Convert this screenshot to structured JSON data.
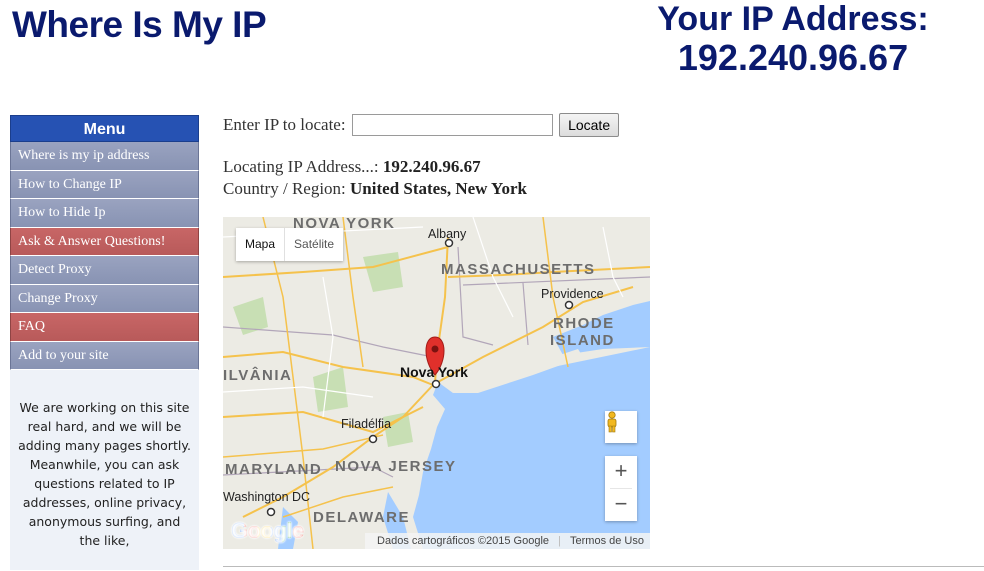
{
  "site_title": "Where Is My IP",
  "ip_header": {
    "label": "Your IP Address:",
    "value": "192.240.96.67"
  },
  "sidebar": {
    "menu_title": "Menu",
    "items": [
      {
        "label": "Where is my ip address"
      },
      {
        "label": "How to Change IP"
      },
      {
        "label": "How to Hide Ip"
      },
      {
        "label": "Ask & Answer Questions!"
      },
      {
        "label": "Detect Proxy"
      },
      {
        "label": "Change Proxy"
      },
      {
        "label": "FAQ"
      },
      {
        "label": "Add to your site"
      }
    ],
    "info_text": "We are working on this site real hard, and we will be adding many pages shortly. Meanwhile, you can ask questions related to IP addresses, online privacy, anonymous surfing, and the like,"
  },
  "locate": {
    "label": "Enter IP to locate:",
    "input_value": "",
    "button_label": "Locate"
  },
  "result": {
    "locating_label": "Locating IP Address...:",
    "locating_value": "192.240.96.67",
    "region_label": "Country / Region:",
    "region_value": "United States, New York"
  },
  "map": {
    "type_map": "Mapa",
    "type_satellite": "Satélite",
    "labels": {
      "nova_york_top": "NOVA YORK",
      "albany": "Albany",
      "massachusetts": "MASSACHUSETTS",
      "providence": "Providence",
      "rhode": "RHODE",
      "island": "ISLAND",
      "pennsylvania": "ILVÂNIA",
      "nova_york_city": "Nova York",
      "filadelfia": "Filadélfia",
      "maryland": "MARYLAND",
      "nova_jersey": "NOVA JERSEY",
      "washington": "Washington DC",
      "delaware": "DELAWARE"
    },
    "zoom_in": "+",
    "zoom_out": "−",
    "attribution": "Dados cartográficos ©2015 Google",
    "terms": "Termos de Uso",
    "logo": "Google"
  },
  "colors": {
    "title": "#0a1a6e",
    "menu_header": "#2652b3",
    "menu_item": "#8893b3",
    "menu_hot": "#b85a5a",
    "water": "#a3ccff",
    "land": "#ecebe4",
    "road": "#f5c24c",
    "marker": "#e0302b"
  }
}
